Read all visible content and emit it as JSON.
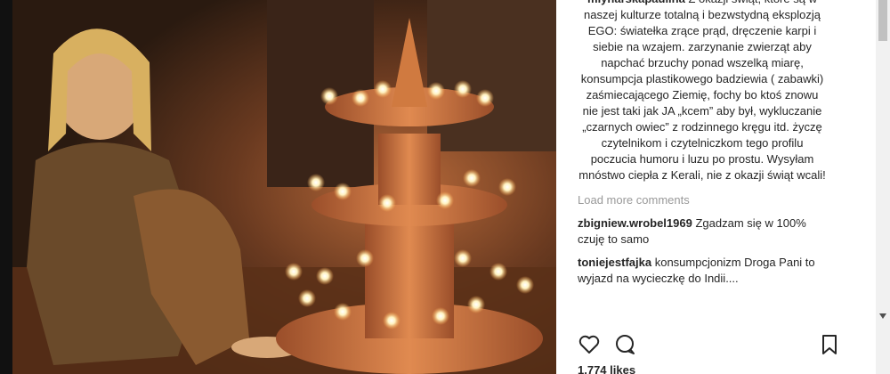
{
  "post": {
    "caption": {
      "username": "mlynarskapaulina",
      "text": "Z okazji świąt, które są w naszej kulturze totalną i bezwstydną eksplozją EGO: światełka zrące prąd, dręczenie karpi i siebie na wzajem. zarzynanie zwierząt aby napchać brzuchy ponad wszelką miarę, konsumpcja plastikowego badziewia ( zabawki) zaśmiecającego Ziemię, fochy bo ktoś znowu nie jest taki jak JA „kcem” aby był, wykluczanie „czarnych owiec” z rodzinnego kręgu itd. życzę czytelnikom i czytelniczkom tego profilu poczucia humoru i luzu po prostu. Wysyłam mnóstwo ciepła z Kerali, nie z okazji świąt wcali!"
    },
    "load_more": "Load more comments",
    "comments": [
      {
        "username": "zbigniew.wrobel1969",
        "text": "Zgadzam się w 100% czuję to samo"
      },
      {
        "username": "toniejestfajka",
        "text": "konsumpcjonizm Droga Pani to wyjazd na wycieczkę do Indii...."
      }
    ],
    "likes": "1,774 likes"
  },
  "icons": {
    "like": "heart-icon",
    "comment": "comment-icon",
    "save": "bookmark-icon"
  },
  "colors": {
    "text": "#262626",
    "muted": "#999999",
    "flame": "#fff2c0",
    "lamp": "#c9753a"
  }
}
